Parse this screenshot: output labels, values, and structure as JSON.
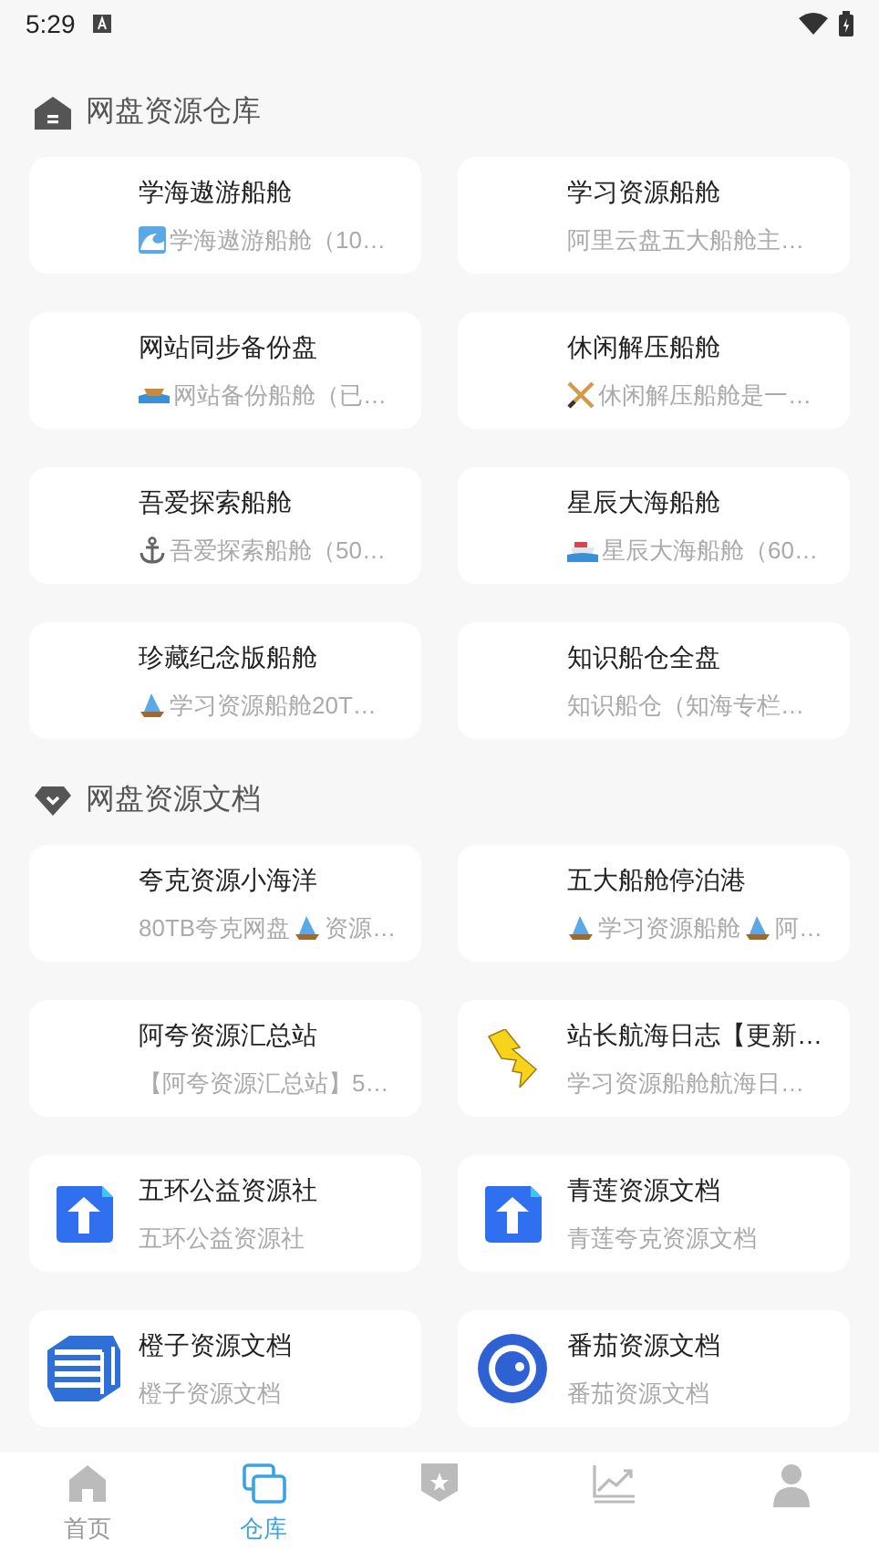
{
  "status_bar": {
    "time": "5:29"
  },
  "sections": [
    {
      "title": "网盘资源仓库",
      "cards": [
        {
          "title": "学海遨游船舱",
          "subtitle": [
            {
              "kind": "wave"
            },
            {
              "kind": "text",
              "text": "学海遨游船舱（10…"
            }
          ]
        },
        {
          "title": "学习资源船舱",
          "subtitle": [
            {
              "kind": "text",
              "text": "阿里云盘五大船舱主…"
            }
          ]
        },
        {
          "title": "网站同步备份盘",
          "subtitle": [
            {
              "kind": "boat"
            },
            {
              "kind": "text",
              "text": "网站备份船舱（已…"
            }
          ]
        },
        {
          "title": "休闲解压船舱",
          "subtitle": [
            {
              "kind": "oars"
            },
            {
              "kind": "text",
              "text": "休闲解压船舱是一…"
            }
          ]
        },
        {
          "title": "吾爱探索船舱",
          "subtitle": [
            {
              "kind": "anchor"
            },
            {
              "kind": "text",
              "text": "吾爱探索船舱（50…"
            }
          ]
        },
        {
          "title": "星辰大海船舱",
          "subtitle": [
            {
              "kind": "ship"
            },
            {
              "kind": "text",
              "text": "星辰大海船舱（60…"
            }
          ]
        },
        {
          "title": "珍藏纪念版船舱",
          "subtitle": [
            {
              "kind": "sailboat"
            },
            {
              "kind": "text",
              "text": "学习资源船舱20T…"
            }
          ]
        },
        {
          "title": "知识船仓全盘",
          "subtitle": [
            {
              "kind": "text",
              "text": "知识船仓（知海专栏…"
            }
          ]
        }
      ]
    },
    {
      "title": "网盘资源文档",
      "cards": [
        {
          "title": "夸克资源小海洋",
          "subtitle": [
            {
              "kind": "text",
              "text": "80TB夸克网盘"
            },
            {
              "kind": "sailboat"
            },
            {
              "kind": "text",
              "text": "资源…"
            }
          ]
        },
        {
          "title": "五大船舱停泊港",
          "subtitle": [
            {
              "kind": "sailboat"
            },
            {
              "kind": "text",
              "text": "学习资源船舱"
            },
            {
              "kind": "sailboat"
            },
            {
              "kind": "text",
              "text": "阿…"
            }
          ]
        },
        {
          "title": "阿夸资源汇总站",
          "subtitle": [
            {
              "kind": "text",
              "text": "【阿夸资源汇总站】5…"
            }
          ]
        },
        {
          "title": "站长航海日志【更新…",
          "kind": "bolt",
          "subtitle": [
            {
              "kind": "text",
              "text": "学习资源船舱航海日…"
            }
          ]
        },
        {
          "title": "五环公益资源社",
          "kind": "arrow",
          "subtitle": [
            {
              "kind": "text",
              "text": "五环公益资源社"
            }
          ]
        },
        {
          "title": "青莲资源文档",
          "kind": "arrow",
          "subtitle": [
            {
              "kind": "text",
              "text": "青莲夸克资源文档"
            }
          ]
        },
        {
          "title": "橙子资源文档",
          "kind": "stack",
          "subtitle": [
            {
              "kind": "text",
              "text": "橙子资源文档"
            }
          ]
        },
        {
          "title": "番茄资源文档",
          "kind": "ring",
          "subtitle": [
            {
              "kind": "text",
              "text": "番茄资源文档"
            }
          ]
        }
      ]
    }
  ],
  "nav": [
    {
      "label": "首页",
      "selected": false
    },
    {
      "label": "仓库",
      "selected": true
    },
    {
      "selected": false
    },
    {
      "selected": false
    },
    {
      "selected": false
    }
  ]
}
